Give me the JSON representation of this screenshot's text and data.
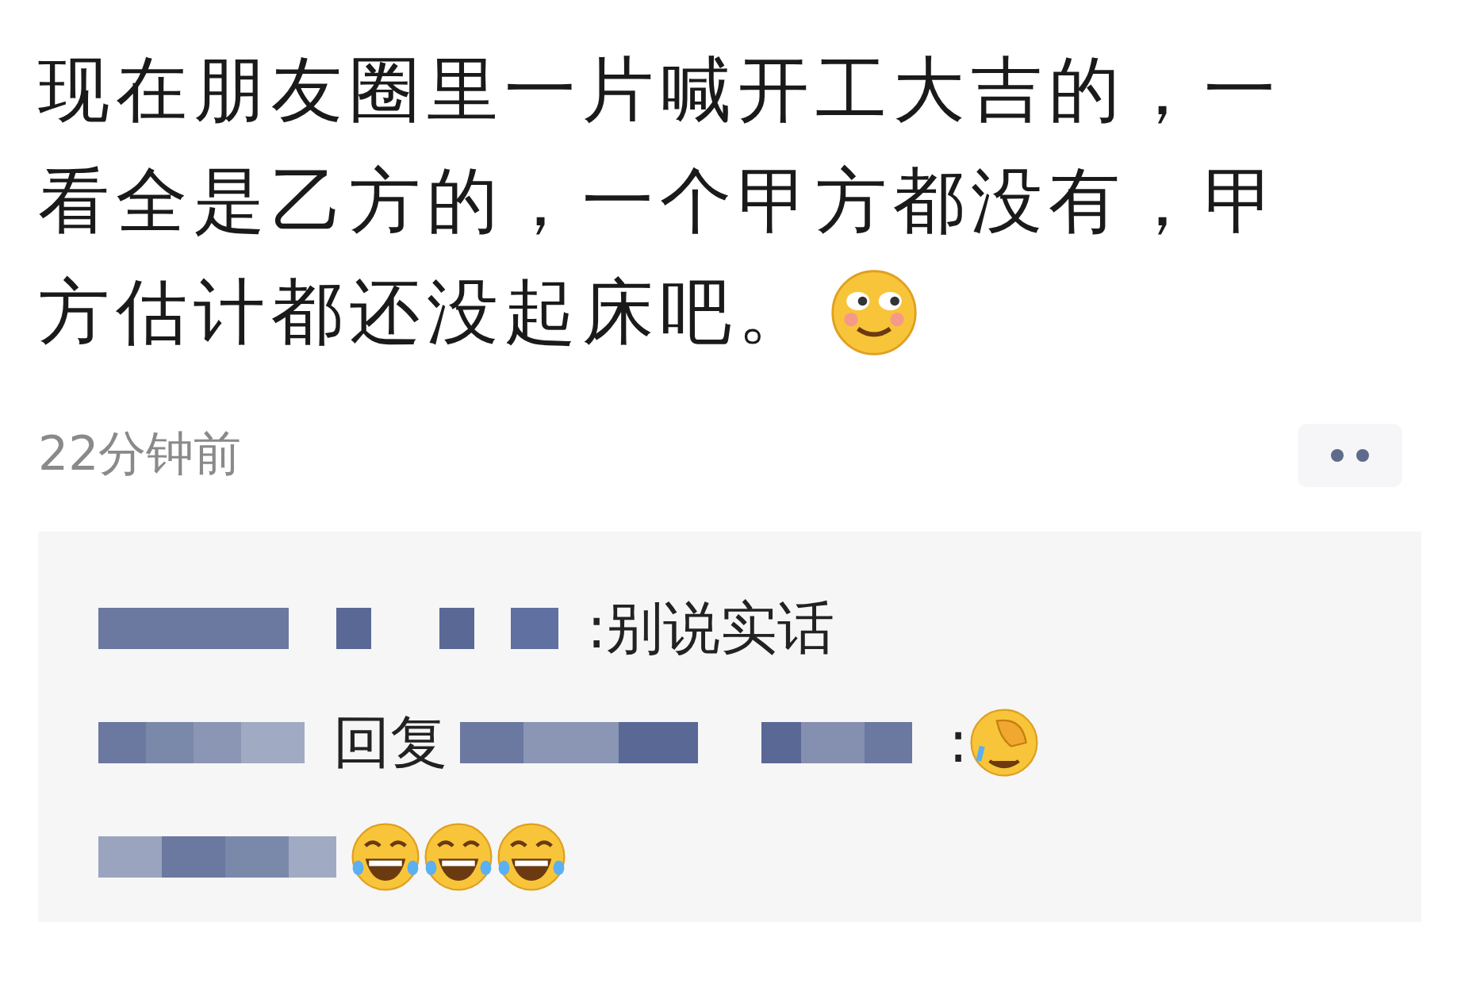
{
  "post": {
    "lines": [
      "现在朋友圈里一片喊开工大吉的，一",
      "看全是乙方的，一个甲方都没有，甲",
      "方估计都还没起床吧。"
    ],
    "time": "22分钟前"
  },
  "comments": [
    {
      "kind": "comment",
      "text": ":别说实话"
    },
    {
      "kind": "reply",
      "reply_word": "回复",
      "text": ":"
    }
  ]
}
